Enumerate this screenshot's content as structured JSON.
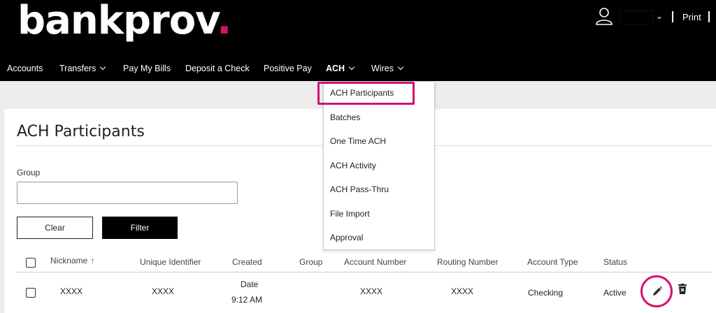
{
  "header": {
    "brand": "bankprov",
    "brand_dot": ".",
    "print_label": "Print",
    "accent_color": "#d1136f"
  },
  "nav": {
    "items": [
      {
        "label": "Accounts"
      },
      {
        "label": "Transfers"
      },
      {
        "label": "Pay My Bills"
      },
      {
        "label": "Deposit a Check"
      },
      {
        "label": "Positive Pay"
      },
      {
        "label": "ACH",
        "active": true
      },
      {
        "label": "Wires"
      }
    ]
  },
  "ach_menu": {
    "items": [
      {
        "label": "ACH Participants",
        "highlighted": true
      },
      {
        "label": "Batches"
      },
      {
        "label": "One Time ACH"
      },
      {
        "label": "ACH Activity"
      },
      {
        "label": "ACH Pass-Thru"
      },
      {
        "label": "File Import"
      },
      {
        "label": "Approval"
      }
    ]
  },
  "page": {
    "title": "ACH Participants",
    "group_label": "Group",
    "group_value": "",
    "clear_label": "Clear",
    "filter_label": "Filter"
  },
  "table": {
    "columns": [
      "Nickname",
      "Unique Identifier",
      "Created",
      "Group",
      "Account Number",
      "Routing Number",
      "Account Type",
      "Status"
    ],
    "sort_icon": "↑",
    "rows": [
      {
        "nickname": "XXXX",
        "unique_identifier": "XXXX",
        "created_date": "Date",
        "created_time": "9:12 AM",
        "group": "",
        "account_number": "XXXX",
        "routing_number": "XXXX",
        "account_type": "Checking",
        "status": "Active"
      }
    ]
  },
  "icons": {
    "user": "user-icon",
    "edit": "pencil-icon",
    "delete": "trash-icon",
    "chevron": "chevron-down-icon"
  }
}
